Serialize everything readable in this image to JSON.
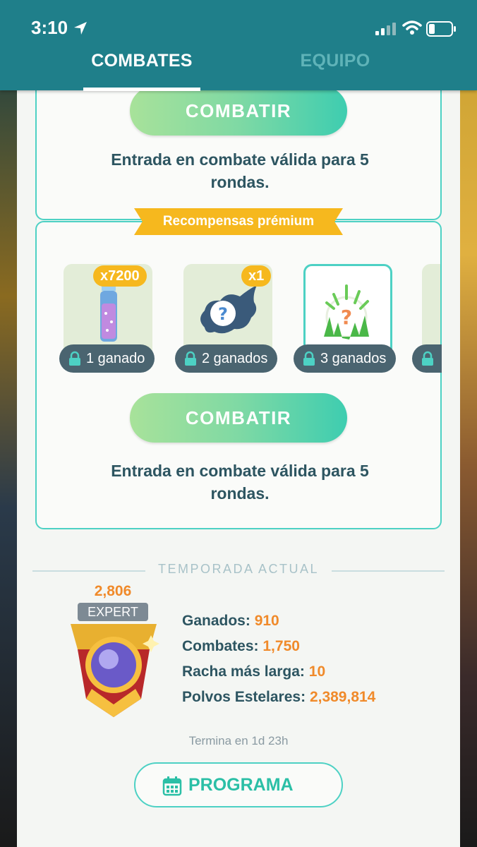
{
  "status_bar": {
    "time": "3:10",
    "icons": [
      "location-arrow-icon",
      "cellular-signal-icon",
      "wifi-icon",
      "battery-icon"
    ]
  },
  "tabs": [
    {
      "label": "COMBATES",
      "active": true
    },
    {
      "label": "EQUIPO",
      "active": false
    }
  ],
  "top_card": {
    "button_label": "COMBATIR",
    "info_line1": "Entrada en combate válida para 5",
    "info_line2": "rondas."
  },
  "premium": {
    "ribbon": "Recompensas prémium",
    "rewards": [
      {
        "badge": "x7200",
        "label": "1 ganado",
        "icon": "stardust-vial-icon"
      },
      {
        "badge": "x1",
        "label": "2 ganados",
        "icon": "mystery-cloud-icon"
      },
      {
        "badge": "",
        "label": "3 ganados",
        "icon": "mystery-grass-icon",
        "selected": true
      },
      {
        "badge": "",
        "label": "",
        "icon": "lock-icon"
      }
    ],
    "button_label": "COMBATIR",
    "info_line1": "Entrada en combate válida para 5",
    "info_line2": "rondas."
  },
  "season": {
    "title": "TEMPORADA ACTUAL",
    "rating": "2,806",
    "rank": "EXPERT",
    "stats": [
      {
        "label": "Ganados:",
        "value": "910"
      },
      {
        "label": "Combates:",
        "value": "1,750"
      },
      {
        "label": "Racha más larga:",
        "value": "10"
      },
      {
        "label": "Polvos Estelares:",
        "value": "2,389,814"
      }
    ],
    "ends": "Termina en 1d 23h",
    "program_label": "PROGRAMA"
  },
  "colors": {
    "header": "#1f7f8a",
    "accent_teal": "#4dd1c4",
    "ribbon_gold": "#f6b81e",
    "value_orange": "#f08a2a",
    "text_dark": "#2d5561"
  }
}
